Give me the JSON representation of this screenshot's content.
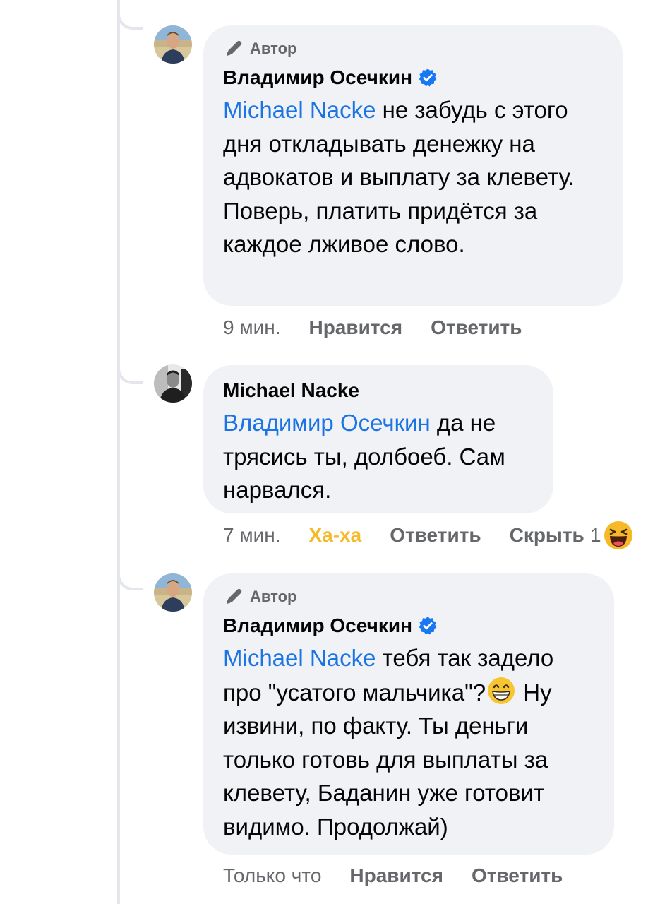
{
  "comments": [
    {
      "author_badge": "Автор",
      "name": "Владимир Осечкин",
      "verified": true,
      "mention": "Michael Nacke",
      "text": " не забудь с этого дня откладывать денежку на адвокатов и выплату за клевету. Поверь, платить придётся за каждое лживое слово.",
      "time": "9 мин.",
      "actions": [
        "Нравится",
        "Ответить"
      ]
    },
    {
      "name": "Michael Nacke",
      "mention": "Владимир Осечкин",
      "text": " да не трясись ты, долбоеб. Сам нарвался.",
      "time": "7 мин.",
      "reaction_label": "Ха-ха",
      "actions": [
        "Ответить",
        "Скрыть"
      ],
      "reaction_count": "1",
      "reaction_icon": "haha-emoji-icon"
    },
    {
      "author_badge": "Автор",
      "name": "Владимир Осечкин",
      "verified": true,
      "mention": "Michael Nacke",
      "text_part1": " тебя так задело про \"усатого мальчика\"?",
      "emoji": "grinning-emoji-icon",
      "text_part2": " Ну извини, по факту. Ты деньги только готовь для выплаты за клевету, Баданин уже готовит видимо. Продолжай)",
      "time": "Только что",
      "actions": [
        "Нравится",
        "Ответить"
      ]
    }
  ],
  "colors": {
    "mention": "#1b74e4",
    "secondary_text": "#65676b",
    "bubble_bg": "#f0f2f5",
    "verified": "#1877f2",
    "haha": "#f7b928"
  }
}
